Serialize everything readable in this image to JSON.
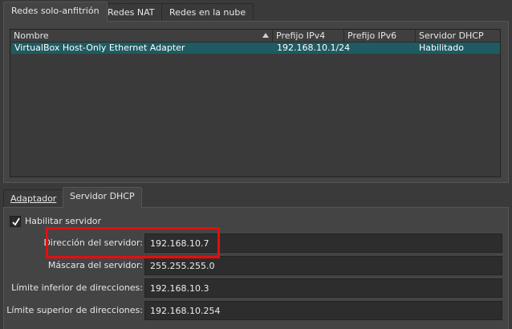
{
  "top_tabs": [
    "Redes solo-anfitrión",
    "Redes NAT",
    "Redes en la nube"
  ],
  "table": {
    "columns": [
      "Nombre",
      "Prefijo IPv4",
      "Prefijo IPv6",
      "Servidor DHCP"
    ],
    "rows": [
      {
        "nombre": "VirtualBox Host-Only Ethernet Adapter",
        "ipv4": "192.168.10.1/24",
        "ipv6": "",
        "dhcp": "Habilitado"
      }
    ]
  },
  "bottom_tabs": [
    "Adaptador",
    "Servidor DHCP"
  ],
  "dhcp": {
    "enable_label": "Habilitar servidor",
    "enabled": true,
    "fields": [
      {
        "label": "Dirección del servidor:",
        "value": "192.168.10.7"
      },
      {
        "label": "Máscara del servidor:",
        "value": "255.255.255.0"
      },
      {
        "label": "Límite inferior de direcciones:",
        "value": "192.168.10.3"
      },
      {
        "label": "Límite superior de direcciones:",
        "value": "192.168.10.254"
      }
    ]
  },
  "colors": {
    "background": "#3a3a3a",
    "selection": "#1f5b62",
    "highlight": "#e60d0d"
  }
}
